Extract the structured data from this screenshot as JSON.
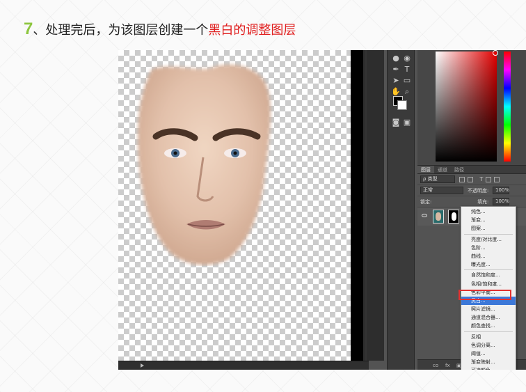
{
  "step": {
    "number": "7",
    "text": "、处理完后，为该图层创建一个",
    "highlight": "黑白的调整图层",
    "number_color": "#8dc63f",
    "highlight_color": "#e01e1e"
  },
  "toolbox": {
    "tools": [
      "drop-icon",
      "burn-icon",
      "pen-icon",
      "text-icon",
      "select-arrow-icon",
      "shape-icon",
      "hand-icon",
      "zoom-icon"
    ]
  },
  "layers_panel": {
    "tabs": [
      "图层",
      "通道",
      "路径"
    ],
    "filter_label": "ρ 类型",
    "blend_mode": "正常",
    "opacity_label": "不透明度:",
    "opacity_value": "100%",
    "lock_label": "锁定:",
    "fill_label": "填充:",
    "fill_value": "100%",
    "bottom_icons": [
      "co",
      "fx"
    ]
  },
  "adjust_menu": {
    "items": [
      {
        "label": "纯色..."
      },
      {
        "label": "渐变..."
      },
      {
        "label": "图案..."
      },
      {
        "sep": true
      },
      {
        "label": "亮度/对比度..."
      },
      {
        "label": "色阶..."
      },
      {
        "label": "曲线..."
      },
      {
        "label": "曝光度..."
      },
      {
        "sep": true
      },
      {
        "label": "自然饱和度..."
      },
      {
        "label": "色相/饱和度..."
      },
      {
        "label": "色彩平衡..."
      },
      {
        "label": "黑白...",
        "selected": true
      },
      {
        "label": "照片滤镜..."
      },
      {
        "label": "通道混合器..."
      },
      {
        "label": "颜色查找..."
      },
      {
        "sep": true
      },
      {
        "label": "反相"
      },
      {
        "label": "色调分离..."
      },
      {
        "label": "阈值..."
      },
      {
        "label": "渐变映射..."
      },
      {
        "label": "可选颜色..."
      }
    ]
  }
}
